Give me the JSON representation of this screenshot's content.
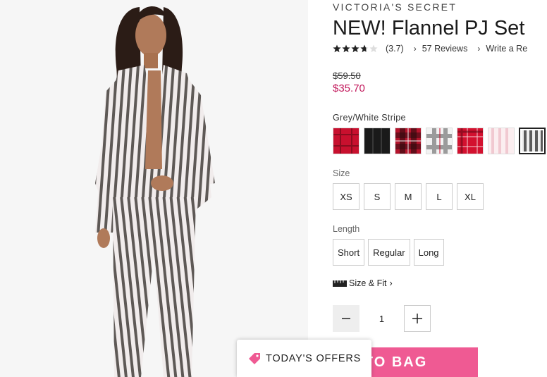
{
  "product": {
    "brand": "VICTORIA'S SECRET",
    "title": "NEW! Flannel PJ Set",
    "rating_value": "(3.7)",
    "rating_stars": 3.7,
    "reviews_link": "57 Reviews",
    "write_review_link": "Write a Re",
    "price_original": "$59.50",
    "price_sale": "$35.70"
  },
  "color": {
    "selected_label": "Grey/White Stripe",
    "swatches": [
      {
        "name": "red-plaid",
        "color": "#c8102e"
      },
      {
        "name": "black-stripe",
        "color": "#1a1a1a"
      },
      {
        "name": "red-black-check",
        "color": "#b5142c"
      },
      {
        "name": "grey-white-plaid",
        "color": "#d6d6d6"
      },
      {
        "name": "red-plaid-2",
        "color": "#d3112f"
      },
      {
        "name": "pink-white-stripe",
        "color": "#f6dbe0"
      },
      {
        "name": "grey-white-stripe",
        "color": "#6b6b6b"
      }
    ]
  },
  "size": {
    "label": "Size",
    "options": [
      "XS",
      "S",
      "M",
      "L",
      "XL"
    ]
  },
  "length": {
    "label": "Length",
    "options": [
      "Short",
      "Regular",
      "Long"
    ]
  },
  "size_fit": {
    "label": "Size & Fit"
  },
  "quantity": {
    "value": "1"
  },
  "cta": {
    "add_to_bag": "ADD TO BAG",
    "todays_offers": "TODAY'S OFFERS"
  },
  "colors": {
    "accent_pink": "#ef5a93",
    "sale_price": "#c2185b"
  }
}
